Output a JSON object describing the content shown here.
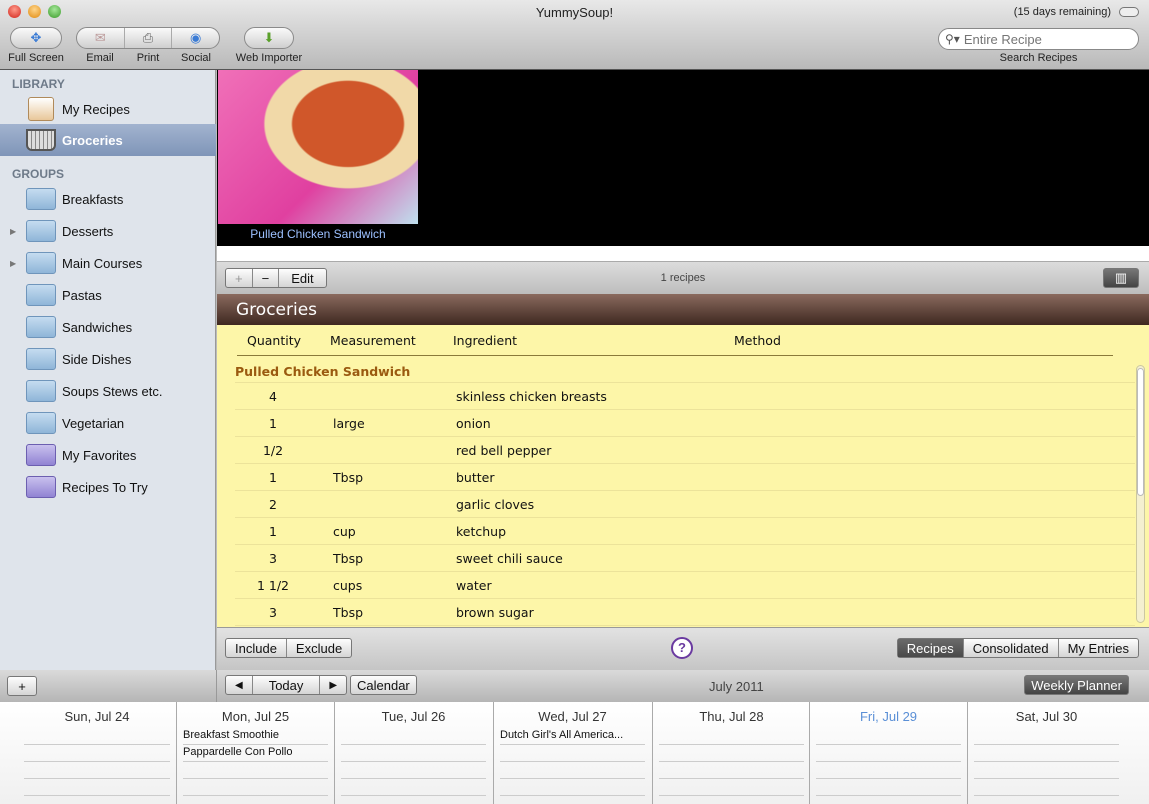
{
  "window": {
    "title": "YummySoup!",
    "trial": "(15 days remaining)"
  },
  "toolbar": {
    "full_screen": "Full Screen",
    "email": "Email",
    "print": "Print",
    "social": "Social",
    "web_importer": "Web Importer",
    "search_placeholder": "Entire Recipe",
    "search_label": "Search Recipes"
  },
  "sidebar": {
    "library_header": "LIBRARY",
    "library": [
      {
        "label": "My Recipes"
      },
      {
        "label": "Groceries",
        "selected": true
      }
    ],
    "groups_header": "GROUPS",
    "groups": [
      {
        "label": "Breakfasts"
      },
      {
        "label": "Desserts",
        "expandable": true
      },
      {
        "label": "Main Courses",
        "expandable": true
      },
      {
        "label": "Pastas"
      },
      {
        "label": "Sandwiches"
      },
      {
        "label": "Side Dishes"
      },
      {
        "label": "Soups Stews etc."
      },
      {
        "label": "Vegetarian"
      },
      {
        "label": "My Favorites",
        "smart": true
      },
      {
        "label": "Recipes To Try",
        "smart": true
      }
    ],
    "add": "+"
  },
  "recipe_browser": {
    "caption": "Pulled Chicken Sandwich",
    "add": "+",
    "remove": "−",
    "edit": "Edit",
    "count": "1 recipes"
  },
  "groceries": {
    "title": "Groceries",
    "columns": [
      "Quantity",
      "Measurement",
      "Ingredient",
      "Method"
    ],
    "recipe": "Pulled Chicken Sandwich",
    "items": [
      {
        "q": "4",
        "m": "",
        "i": "skinless chicken breasts"
      },
      {
        "q": "1",
        "m": "large",
        "i": "onion"
      },
      {
        "q": "1/2",
        "m": "",
        "i": "red bell pepper"
      },
      {
        "q": "1",
        "m": "Tbsp",
        "i": "butter"
      },
      {
        "q": "2",
        "m": "",
        "i": "garlic cloves"
      },
      {
        "q": "1",
        "m": "cup",
        "i": "ketchup"
      },
      {
        "q": "3",
        "m": "Tbsp",
        "i": "sweet chili sauce"
      },
      {
        "q": "1 1/2",
        "m": "cups",
        "i": "water"
      },
      {
        "q": "3",
        "m": "Tbsp",
        "i": "brown sugar"
      }
    ]
  },
  "list_bar": {
    "include": "Include",
    "exclude": "Exclude",
    "help": "?",
    "views": [
      "Recipes",
      "Consolidated",
      "My Entries"
    ],
    "active_view": "Recipes"
  },
  "calendar": {
    "prev": "◀",
    "today": "Today",
    "next": "▶",
    "calendar": "Calendar",
    "month": "July 2011",
    "weekly": "Weekly Planner",
    "days": [
      {
        "label": "Sun, Jul 24",
        "events": []
      },
      {
        "label": "Mon, Jul 25",
        "events": [
          "Breakfast Smoothie",
          "Pappardelle Con Pollo"
        ]
      },
      {
        "label": "Tue, Jul 26",
        "events": []
      },
      {
        "label": "Wed, Jul 27",
        "events": [
          "Dutch Girl's All America..."
        ]
      },
      {
        "label": "Thu, Jul 28",
        "events": []
      },
      {
        "label": "Fri, Jul 29",
        "events": [],
        "today": true
      },
      {
        "label": "Sat, Jul 30",
        "events": []
      }
    ]
  },
  "colors": {
    "today": "#5a8fd6",
    "header_brown": "#5a3e33",
    "list_yellow": "#fdf6a8"
  }
}
